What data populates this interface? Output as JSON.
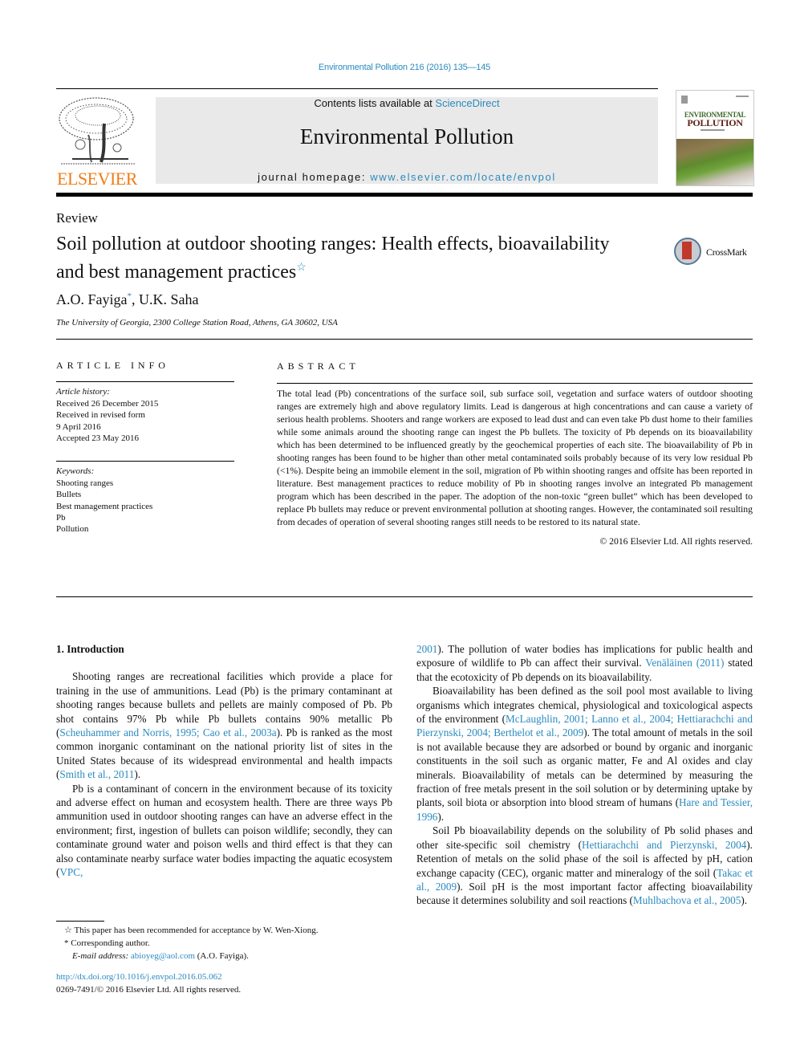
{
  "header": {
    "citation": "Environmental Pollution 216 (2016) 135—145",
    "contents_prefix": "Contents lists available at ",
    "contents_link": "ScienceDirect",
    "journal_title": "Environmental Pollution",
    "homepage_prefix": "journal homepage: ",
    "homepage_link": "www.elsevier.com/locate/envpol",
    "publisher_logo_text": "ELSEVIER",
    "cover": {
      "title_line1": "ENVIRONMENTAL",
      "title_line2": "POLLUTION"
    },
    "colors": {
      "link": "#2a8abf",
      "elsevier_orange": "#f07d1a",
      "banner_bg": "#e9e9e9"
    }
  },
  "article": {
    "type": "Review",
    "title": "Soil pollution at outdoor shooting ranges: Health effects, bioavailability and best management practices",
    "title_mark": "☆",
    "crossmark_label": "CrossMark",
    "authors": [
      {
        "name": "A.O. Fayiga",
        "mark": "*"
      },
      {
        "name": "U.K. Saha",
        "mark": ""
      }
    ],
    "author_separator": ", ",
    "affiliation": "The University of Georgia, 2300 College Station Road, Athens, GA 30602, USA"
  },
  "article_info": {
    "heading": "ARTICLE INFO",
    "history_label": "Article history:",
    "history": [
      "Received 26 December 2015",
      "Received in revised form",
      "9 April 2016",
      "Accepted 23 May 2016"
    ],
    "keywords_label": "Keywords:",
    "keywords": [
      "Shooting ranges",
      "Bullets",
      "Best management practices",
      "Pb",
      "Pollution"
    ]
  },
  "abstract": {
    "heading": "ABSTRACT",
    "text": "The total lead (Pb) concentrations of the surface soil, sub surface soil, vegetation and surface waters of outdoor shooting ranges are extremely high and above regulatory limits. Lead is dangerous at high concentrations and can cause a variety of serious health problems. Shooters and range workers are exposed to lead dust and can even take Pb dust home to their families while some animals around the shooting range can ingest the Pb bullets. The toxicity of Pb depends on its bioavailability which has been determined to be influenced greatly by the geochemical properties of each site. The bioavailability of Pb in shooting ranges has been found to be higher than other metal contaminated soils probably because of its very low residual Pb (<1%). Despite being an immobile element in the soil, migration of Pb within shooting ranges and offsite has been reported in literature. Best management practices to reduce mobility of Pb in shooting ranges involve an integrated Pb management program which has been described in the paper. The adoption of the non-toxic “green bullet” which has been developed to replace Pb bullets may reduce or prevent environmental pollution at shooting ranges. However, the contaminated soil resulting from decades of operation of several shooting ranges still needs to be restored to its natural state.",
    "copyright": "© 2016 Elsevier Ltd. All rights reserved."
  },
  "body": {
    "section_title": "1.  Introduction",
    "p1": {
      "t1": "Shooting ranges are recreational facilities which provide a place for training in the use of ammunitions. Lead (Pb) is the primary contaminant at shooting ranges because bullets and pellets are mainly composed of Pb. Pb shot contains 97% Pb while Pb bullets contains 90% metallic Pb (",
      "c1": "Scheuhammer and Norris, 1995; Cao et al., 2003a",
      "t2": "). Pb is ranked as the most common inorganic contaminant on the national priority list of sites in the United States because of its widespread environmental and health impacts (",
      "c2": "Smith et al., 2011",
      "t3": ")."
    },
    "p2": {
      "t1": "Pb is a contaminant of concern in the environment because of its toxicity and adverse effect on human and ecosystem health. There are three ways Pb ammunition used in outdoor shooting ranges can have an adverse effect in the environment; first, ingestion of bullets can poison wildlife; secondly, they can contaminate ground water and poison wells and third effect is that they can also contaminate nearby surface water bodies impacting the aquatic ecosystem (",
      "c1": "VPC, 2001",
      "t2": "). The pollution of water bodies has implications for public health and exposure of wildlife to Pb can affect their survival. ",
      "c2": "Venäläinen (2011)",
      "t3": " stated that the ecotoxicity of Pb depends on its bioavailability."
    },
    "p2_left_part": "Pb is a contaminant of concern in the environment because of its toxicity and adverse effect on human and ecosystem health. There are three ways Pb ammunition used in outdoor shooting ranges can have an adverse effect in the environment; first, ingestion of bullets can poison wildlife; secondly, they can contaminate ground water and poison wells and third effect is that they can also contaminate nearby surface water bodies impacting the aquatic ecosystem (",
    "p2_left_cite": "VPC,",
    "p2_right_cite": "2001",
    "p2_right_t2": "). The pollution of water bodies has implications for public health and exposure of wildlife to Pb can affect their survival. ",
    "p2_right_c2": "Venäläinen (2011)",
    "p2_right_t3": " stated that the ecotoxicity of Pb depends on its bioavailability.",
    "p3": {
      "t1": "Bioavailability has been defined as the soil pool most available to living organisms which integrates chemical, physiological and toxicological aspects of the environment (",
      "c1": "McLaughlin, 2001; Lanno et al., 2004; Hettiarachchi and Pierzynski, 2004; Berthelot et al., 2009",
      "t2": "). The total amount of metals in the soil is not available because they are adsorbed or bound by organic and inorganic constituents in the soil such as organic matter, Fe and Al oxides and clay minerals. Bioavailability of metals can be determined by measuring the fraction of free metals present in the soil solution or by determining uptake by plants, soil biota or absorption into blood stream of humans (",
      "c2": "Hare and Tessier, 1996",
      "t3": ")."
    },
    "p4": {
      "t1": "Soil Pb bioavailability depends on the solubility of Pb solid phases and other site-specific soil chemistry (",
      "c1": "Hettiarachchi and Pierzynski, 2004",
      "t2": "). Retention of metals on the solid phase of the soil is affected by pH, cation exchange capacity (CEC), organic matter and mineralogy of the soil (",
      "c2": "Takac et al., 2009",
      "t3": "). Soil pH is the most important factor affecting bioavailability because it determines solubility and soil reactions (",
      "c3": "Muhlbachova et al., 2005",
      "t4": ")."
    }
  },
  "footnotes": {
    "star_note": "This paper has been recommended for acceptance by W. Wen-Xiong.",
    "star_mark": "☆",
    "corresponding": "Corresponding author.",
    "corresponding_mark": "*",
    "email_label": "E-mail address:",
    "email": "abioyeg@aol.com",
    "email_owner": " (A.O. Fayiga).",
    "doi": "http://dx.doi.org/10.1016/j.envpol.2016.05.062",
    "issn_copyright": "0269-7491/© 2016 Elsevier Ltd. All rights reserved."
  }
}
